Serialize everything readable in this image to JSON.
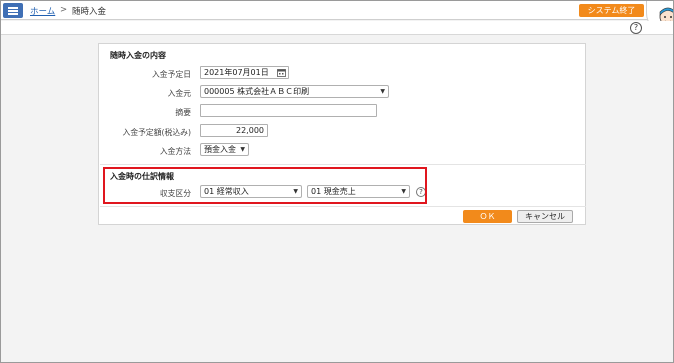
{
  "breadcrumb": {
    "home": "ホーム",
    "separator": ">",
    "current": "随時入金"
  },
  "header": {
    "system_exit": "システム終了",
    "help": "?"
  },
  "form": {
    "section1_title": "随時入金の内容",
    "scheduled_date_label": "入金予定日",
    "scheduled_date_value": "2021年07月01日",
    "payer_label": "入金元",
    "payer_value": "000005 株式会社ＡＢＣ印刷",
    "summary_label": "摘要",
    "summary_value": "",
    "amount_label": "入金予定額(税込み)",
    "amount_value": "22,000",
    "method_label": "入金方法",
    "method_value": "預金入金"
  },
  "journal": {
    "section_title": "入金時の仕訳情報",
    "category_label": "収支区分",
    "category1_value": "01 経常収入",
    "category2_value": "01 現金売上",
    "help": "?"
  },
  "actions": {
    "ok": "ＯＫ",
    "cancel": "キャンセル"
  },
  "colors": {
    "accent": "#f28a1b",
    "menu": "#3f6fb5",
    "highlight": "#e0161e",
    "link": "#1f5fb0"
  },
  "icons": {
    "menu": "hamburger-icon",
    "calendar": "calendar-icon",
    "help": "help-icon",
    "avatar": "avatar-icon"
  }
}
